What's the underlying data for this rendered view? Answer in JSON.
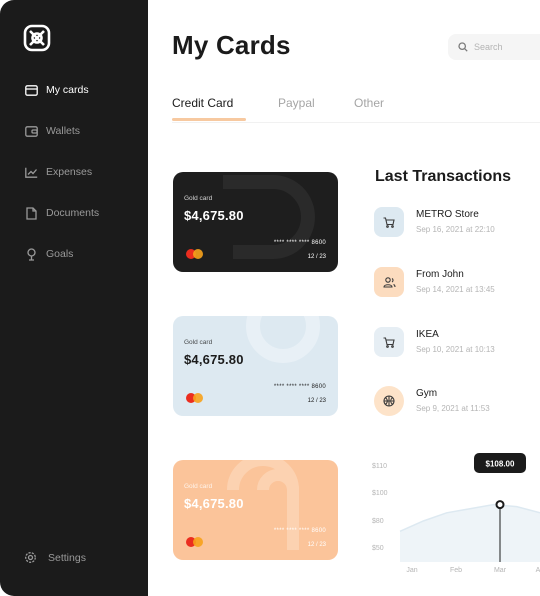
{
  "sidebar": {
    "logo_icon": "brand-logo",
    "items": [
      {
        "label": "My cards",
        "icon": "credit-card-icon",
        "active": true
      },
      {
        "label": "Wallets",
        "icon": "wallet-icon",
        "active": false
      },
      {
        "label": "Expenses",
        "icon": "line-chart-icon",
        "active": false
      },
      {
        "label": "Documents",
        "icon": "document-icon",
        "active": false
      },
      {
        "label": "Goals",
        "icon": "trophy-icon",
        "active": false
      }
    ],
    "settings_label": "Settings"
  },
  "header": {
    "title": "My Cards",
    "search_placeholder": "Search"
  },
  "tabs": [
    {
      "label": "Credit Card",
      "active": true
    },
    {
      "label": "Paypal",
      "active": false
    },
    {
      "label": "Other",
      "active": false
    }
  ],
  "cards": [
    {
      "type": "Gold card",
      "amount": "$4,675.80",
      "number": "**** **** **** 8600",
      "expiry": "12 / 23",
      "theme": "dark"
    },
    {
      "type": "Gold card",
      "amount": "$4,675.80",
      "number": "**** **** **** 8600",
      "expiry": "12 / 23",
      "theme": "blue"
    },
    {
      "type": "Gold card",
      "amount": "$4,675.80",
      "number": "**** **** **** 8600",
      "expiry": "12 / 23",
      "theme": "orange"
    }
  ],
  "transactions": {
    "title": "Last Transactions",
    "items": [
      {
        "name": "METRO Store",
        "date": "Sep 16, 2021 at 22:10",
        "icon": "shopping-cart-icon",
        "color": "#dde9f1"
      },
      {
        "name": "From John",
        "date": "Sep 14, 2021 at 13:45",
        "icon": "users-icon",
        "color": "#fcdcbf"
      },
      {
        "name": "IKEA",
        "date": "Sep 10, 2021 at 10:13",
        "icon": "shopping-cart-icon",
        "color": "#e6eef4"
      },
      {
        "name": "Gym",
        "date": "Sep 9, 2021 at 11:53",
        "icon": "basketball-icon",
        "color": "#fde3c9"
      }
    ]
  },
  "chart_data": {
    "type": "area",
    "x": [
      "Jan",
      "Feb",
      "Mar",
      "A"
    ],
    "values": [
      95,
      100,
      104,
      106,
      108,
      107,
      104
    ],
    "yticks": [
      "$110",
      "$100",
      "$80",
      "$50"
    ],
    "highlight": {
      "x": "Mar",
      "label": "$108.00"
    },
    "colors": {
      "line": "#dde9f1",
      "area": "#eef4f8",
      "tooltip": "#1b1b1b"
    }
  },
  "colors": {
    "sidebar": "#1b1b1b",
    "accent": "#f7c9a0"
  }
}
